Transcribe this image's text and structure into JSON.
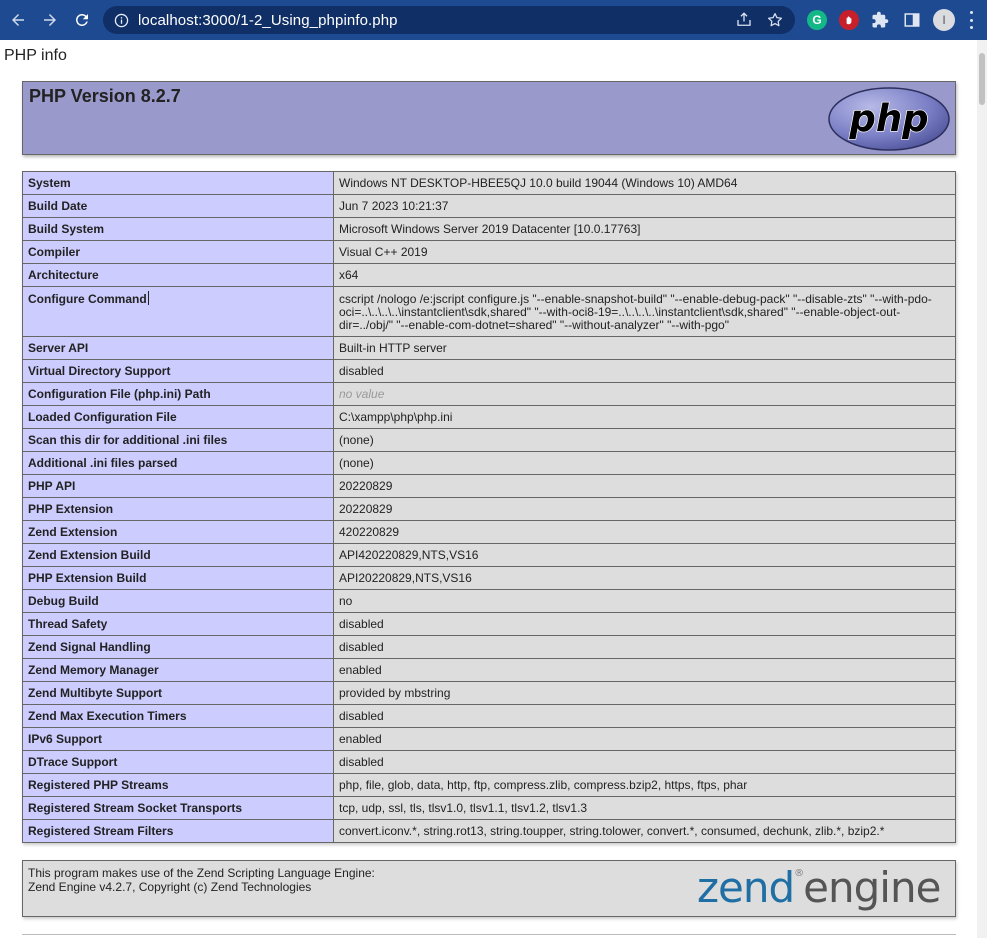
{
  "browser": {
    "url": "localhost:3000/1-2_Using_phpinfo.php",
    "extension_g": "G",
    "avatar_letter": "I"
  },
  "page": {
    "doc_title": "PHP info",
    "heading": "PHP Version 8.2.7",
    "logo_text": "php"
  },
  "rows": [
    {
      "label": "System",
      "value": "Windows NT DESKTOP-HBEE5QJ 10.0 build 19044 (Windows 10) AMD64"
    },
    {
      "label": "Build Date",
      "value": "Jun 7 2023 10:21:37"
    },
    {
      "label": "Build System",
      "value": "Microsoft Windows Server 2019 Datacenter [10.0.17763]"
    },
    {
      "label": "Compiler",
      "value": "Visual C++ 2019"
    },
    {
      "label": "Architecture",
      "value": "x64"
    },
    {
      "label": "Configure Command",
      "value": "cscript /nologo /e:jscript configure.js \"--enable-snapshot-build\" \"--enable-debug-pack\" \"--disable-zts\" \"--with-pdo-oci=..\\..\\..\\..\\instantclient\\sdk,shared\" \"--with-oci8-19=..\\..\\..\\..\\instantclient\\sdk,shared\" \"--enable-object-out-dir=../obj/\" \"--enable-com-dotnet=shared\" \"--without-analyzer\" \"--with-pgo\""
    },
    {
      "label": "Server API",
      "value": "Built-in HTTP server"
    },
    {
      "label": "Virtual Directory Support",
      "value": "disabled"
    },
    {
      "label": "Configuration File (php.ini) Path",
      "value": "no value"
    },
    {
      "label": "Loaded Configuration File",
      "value": "C:\\xampp\\php\\php.ini"
    },
    {
      "label": "Scan this dir for additional .ini files",
      "value": "(none)"
    },
    {
      "label": "Additional .ini files parsed",
      "value": "(none)"
    },
    {
      "label": "PHP API",
      "value": "20220829"
    },
    {
      "label": "PHP Extension",
      "value": "20220829"
    },
    {
      "label": "Zend Extension",
      "value": "420220829"
    },
    {
      "label": "Zend Extension Build",
      "value": "API420220829,NTS,VS16"
    },
    {
      "label": "PHP Extension Build",
      "value": "API20220829,NTS,VS16"
    },
    {
      "label": "Debug Build",
      "value": "no"
    },
    {
      "label": "Thread Safety",
      "value": "disabled"
    },
    {
      "label": "Zend Signal Handling",
      "value": "disabled"
    },
    {
      "label": "Zend Memory Manager",
      "value": "enabled"
    },
    {
      "label": "Zend Multibyte Support",
      "value": "provided by mbstring"
    },
    {
      "label": "Zend Max Execution Timers",
      "value": "disabled"
    },
    {
      "label": "IPv6 Support",
      "value": "enabled"
    },
    {
      "label": "DTrace Support",
      "value": "disabled"
    },
    {
      "label": "Registered PHP Streams",
      "value": "php, file, glob, data, http, ftp, compress.zlib, compress.bzip2, https, ftps, phar"
    },
    {
      "label": "Registered Stream Socket Transports",
      "value": "tcp, udp, ssl, tls, tlsv1.0, tlsv1.1, tlsv1.2, tlsv1.3"
    },
    {
      "label": "Registered Stream Filters",
      "value": "convert.iconv.*, string.rot13, string.toupper, string.tolower, convert.*, consumed, dechunk, zlib.*, bzip2.*"
    }
  ],
  "footer": {
    "line1": "This program makes use of the Zend Scripting Language Engine:",
    "line2": "Zend Engine v4.2.7, Copyright (c) Zend Technologies",
    "logo_word1": "zend",
    "logo_word2": "engine"
  },
  "colors": {
    "chrome": "#1e4a91",
    "header": "#9999cc",
    "label_cell": "#ccccff",
    "value_cell": "#dddddd",
    "zend_blue": "#1f6fa5"
  }
}
